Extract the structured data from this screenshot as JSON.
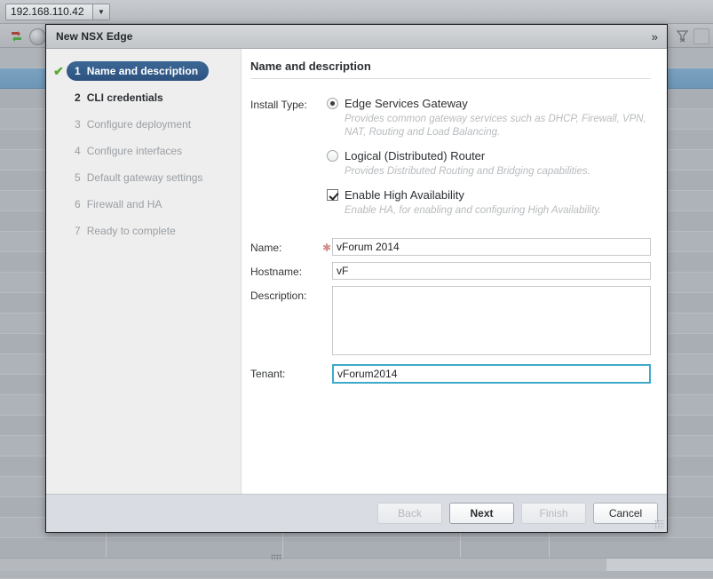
{
  "background": {
    "host_combo": {
      "value": "192.168.110.42",
      "arrow_icon": "chevron-down-icon"
    },
    "icons": {
      "sync_arrows": "sync-arrows-icon",
      "globe": "globe-icon",
      "filter": "filter-clear-icon",
      "extra": "panel-icon"
    }
  },
  "dialog": {
    "title": "New NSX Edge",
    "expand_icon": "»",
    "steps": [
      {
        "num": "1",
        "label": "Name and description",
        "state": "active",
        "check": "✔"
      },
      {
        "num": "2",
        "label": "CLI credentials",
        "state": "next",
        "check": ""
      },
      {
        "num": "3",
        "label": "Configure deployment",
        "state": "todo",
        "check": ""
      },
      {
        "num": "4",
        "label": "Configure interfaces",
        "state": "todo",
        "check": ""
      },
      {
        "num": "5",
        "label": "Default gateway settings",
        "state": "todo",
        "check": ""
      },
      {
        "num": "6",
        "label": "Firewall and HA",
        "state": "todo",
        "check": ""
      },
      {
        "num": "7",
        "label": "Ready to complete",
        "state": "todo",
        "check": ""
      }
    ],
    "content": {
      "heading": "Name and description",
      "install_type_label": "Install Type:",
      "options": [
        {
          "label": "Edge Services Gateway",
          "checked": true,
          "description": "Provides common gateway services such as DHCP, Firewall, VPN, NAT, Routing and Load Balancing."
        },
        {
          "label": "Logical (Distributed) Router",
          "checked": false,
          "description": "Provides Distributed Routing and Bridging  capabilities."
        }
      ],
      "ha": {
        "label": "Enable High Availability",
        "checked": true,
        "description": "Enable HA, for enabling and configuring High Availability."
      },
      "fields": [
        {
          "label": "Name:",
          "value": "vForum 2014",
          "required": true,
          "type": "text",
          "focused": false
        },
        {
          "label": "Hostname:",
          "value": "vF",
          "required": false,
          "type": "text",
          "focused": false
        },
        {
          "label": "Description:",
          "value": "",
          "required": false,
          "type": "textarea",
          "focused": false
        },
        {
          "label": "Tenant:",
          "value": "vForum2014",
          "required": false,
          "type": "text",
          "focused": true
        }
      ],
      "required_marker": "✱"
    },
    "footer": {
      "buttons": [
        {
          "label": "Back",
          "disabled": true,
          "primary": false
        },
        {
          "label": "Next",
          "disabled": false,
          "primary": true
        },
        {
          "label": "Finish",
          "disabled": true,
          "primary": false
        },
        {
          "label": "Cancel",
          "disabled": false,
          "primary": false
        }
      ]
    }
  }
}
